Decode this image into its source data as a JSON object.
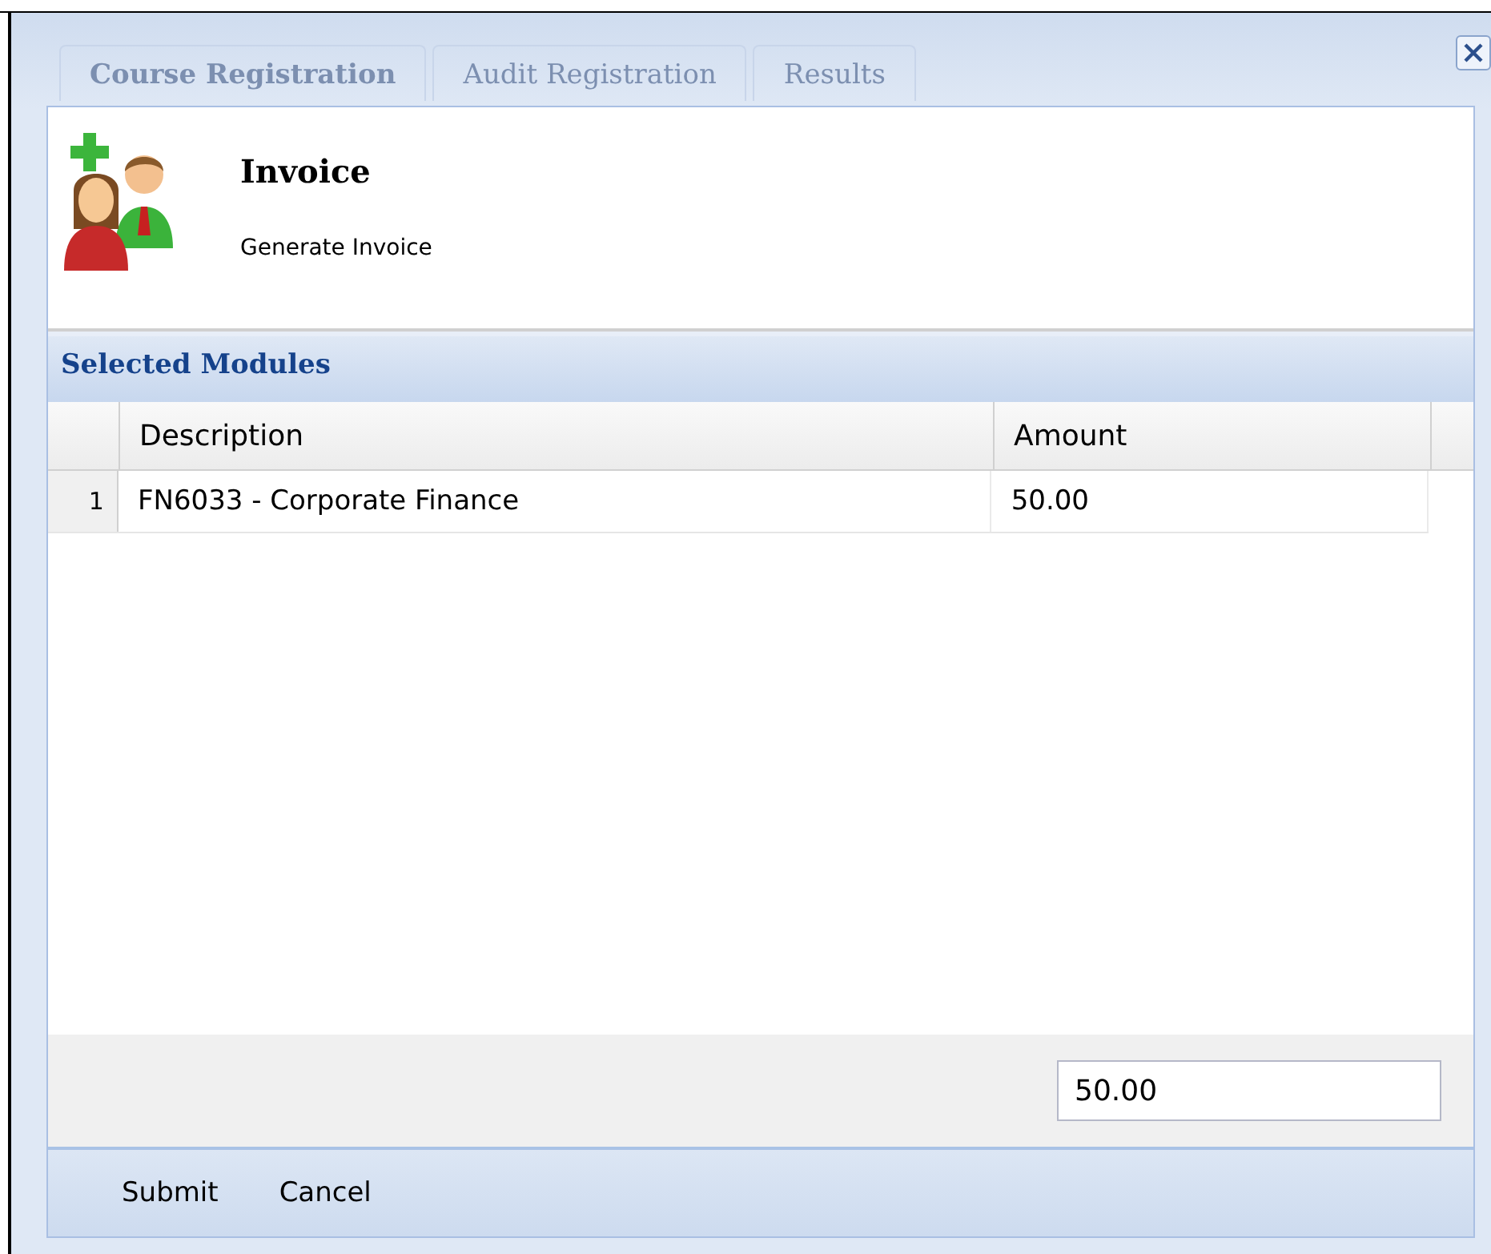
{
  "background_tabs": [
    {
      "label": "Course Registration",
      "selected": true
    },
    {
      "label": "Audit Registration",
      "selected": false
    },
    {
      "label": "Results",
      "selected": false
    }
  ],
  "header": {
    "title": "Invoice",
    "subtitle": "Generate Invoice"
  },
  "section": {
    "title": "Selected Modules"
  },
  "table": {
    "columns": [
      "Description",
      "Amount"
    ],
    "rows": [
      {
        "number": "1",
        "description": "FN6033 - Corporate Finance",
        "amount": "50.00"
      }
    ]
  },
  "total": {
    "value": "50.00"
  },
  "buttons": [
    "Submit",
    "Cancel"
  ]
}
